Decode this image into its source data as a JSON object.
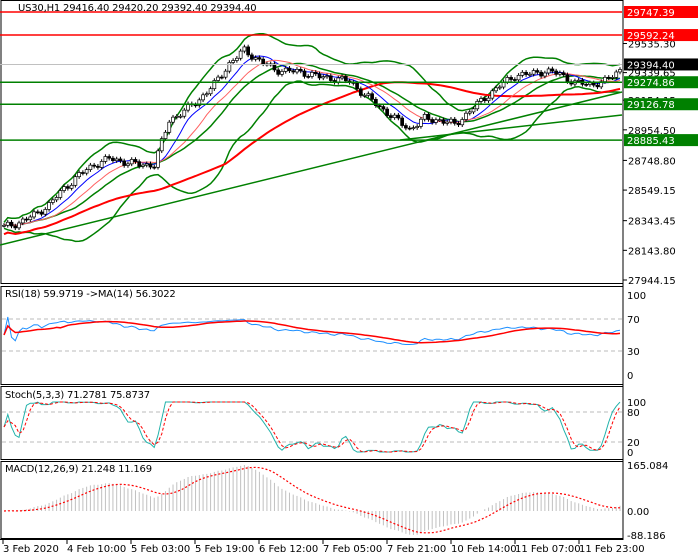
{
  "header": {
    "symbol_info": "US30,H1  29416.40 29420.20 29392.40 29394.40"
  },
  "price_axis": {
    "ticks": [
      "29535.30",
      "29339.65",
      "29154.15",
      "28954.50",
      "28748.80",
      "28549.15",
      "28343.45",
      "28143.80",
      "27944.15"
    ]
  },
  "levels": [
    {
      "value": "29747.39",
      "color": "#ff0000"
    },
    {
      "value": "29592.24",
      "color": "#ff0000"
    },
    {
      "value": "29394.40",
      "color": "#000000"
    },
    {
      "value": "29274.86",
      "color": "#008000"
    },
    {
      "value": "29126.78",
      "color": "#008000"
    },
    {
      "value": "28885.43",
      "color": "#008000"
    }
  ],
  "rsi": {
    "label": "RSI(18) 59.9719  ->MA(14) 56.3022",
    "ticks": [
      "100",
      "70",
      "30",
      "0"
    ]
  },
  "stoch": {
    "label": "Stoch(5,3,3) 71.2781 75.8737",
    "ticks": [
      "100",
      "80",
      "20",
      "0"
    ]
  },
  "macd": {
    "label": "MACD(12,26,9) 21.248 11.169",
    "ticks": [
      "165.084",
      "0.00",
      "-88.186"
    ]
  },
  "time_axis": [
    "3 Feb 2020",
    "4 Feb 10:00",
    "5 Feb 03:00",
    "5 Feb 19:00",
    "6 Feb 12:00",
    "7 Feb 05:00",
    "7 Feb 21:00",
    "10 Feb 14:00",
    "11 Feb 07:00",
    "11 Feb 23:00"
  ],
  "chart_data": {
    "type": "candlestick",
    "timeframe": "H1",
    "ylim": [
      27944.15,
      29747.39
    ],
    "close_every_4_bars": [
      28300,
      28330,
      28380,
      28450,
      28560,
      28650,
      28720,
      28760,
      28740,
      28720,
      28720,
      29020,
      29080,
      29160,
      29260,
      29400,
      29490,
      29420,
      29360,
      29350,
      29340,
      29310,
      29300,
      29280,
      29190,
      29110,
      29030,
      28960,
      29030,
      29020,
      28990,
      29080,
      29170,
      29250,
      29320,
      29330,
      29350,
      29330,
      29270,
      29260,
      29280,
      29360
    ],
    "colors": {
      "candles": "#000000",
      "ma_slow": "#ff0000",
      "ma_fast": "#0000ff",
      "bands": "#008000",
      "rsi": "#1e90ff",
      "signal": "#ff0000",
      "stoch_main": "#20b2aa",
      "macd_hist": "#c0c0c0"
    }
  }
}
